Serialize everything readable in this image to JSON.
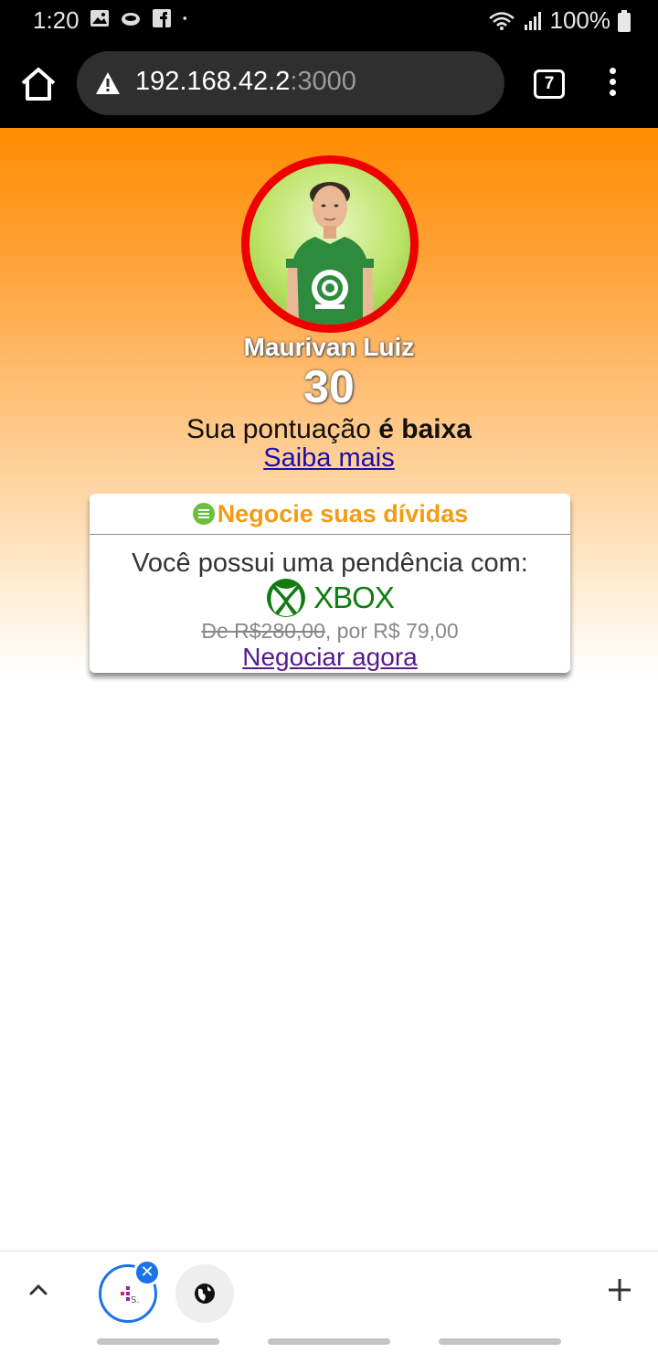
{
  "status_bar": {
    "time": "1:20",
    "battery": "100%",
    "icons": [
      "image-icon",
      "cloud-icon",
      "facebook-icon",
      "dot-icon",
      "wifi-icon",
      "signal-icon",
      "battery-icon"
    ]
  },
  "browser": {
    "url_host": "192.168.42.2",
    "url_port": ":3000",
    "tab_count": "7"
  },
  "profile": {
    "name": "Maurivan Luiz",
    "score": "30",
    "score_msg_prefix": "Sua pontuação",
    "score_msg_strong": "é baixa",
    "learn_more": "Saiba mais"
  },
  "card": {
    "title": "Negocie suas dívidas",
    "line1": "Você possui uma pendência com:",
    "brand": "XBOX",
    "price_old": "De R$280,00",
    "price_new": ", por R$ 79,00",
    "cta": "Negociar agora"
  },
  "colors": {
    "accent_orange": "#f39c12",
    "avatar_border": "#ee0000",
    "xbox_green": "#107c10",
    "link_blue": "#1a0dab",
    "link_visited": "#551a8b",
    "tab_active": "#1a73e8"
  }
}
